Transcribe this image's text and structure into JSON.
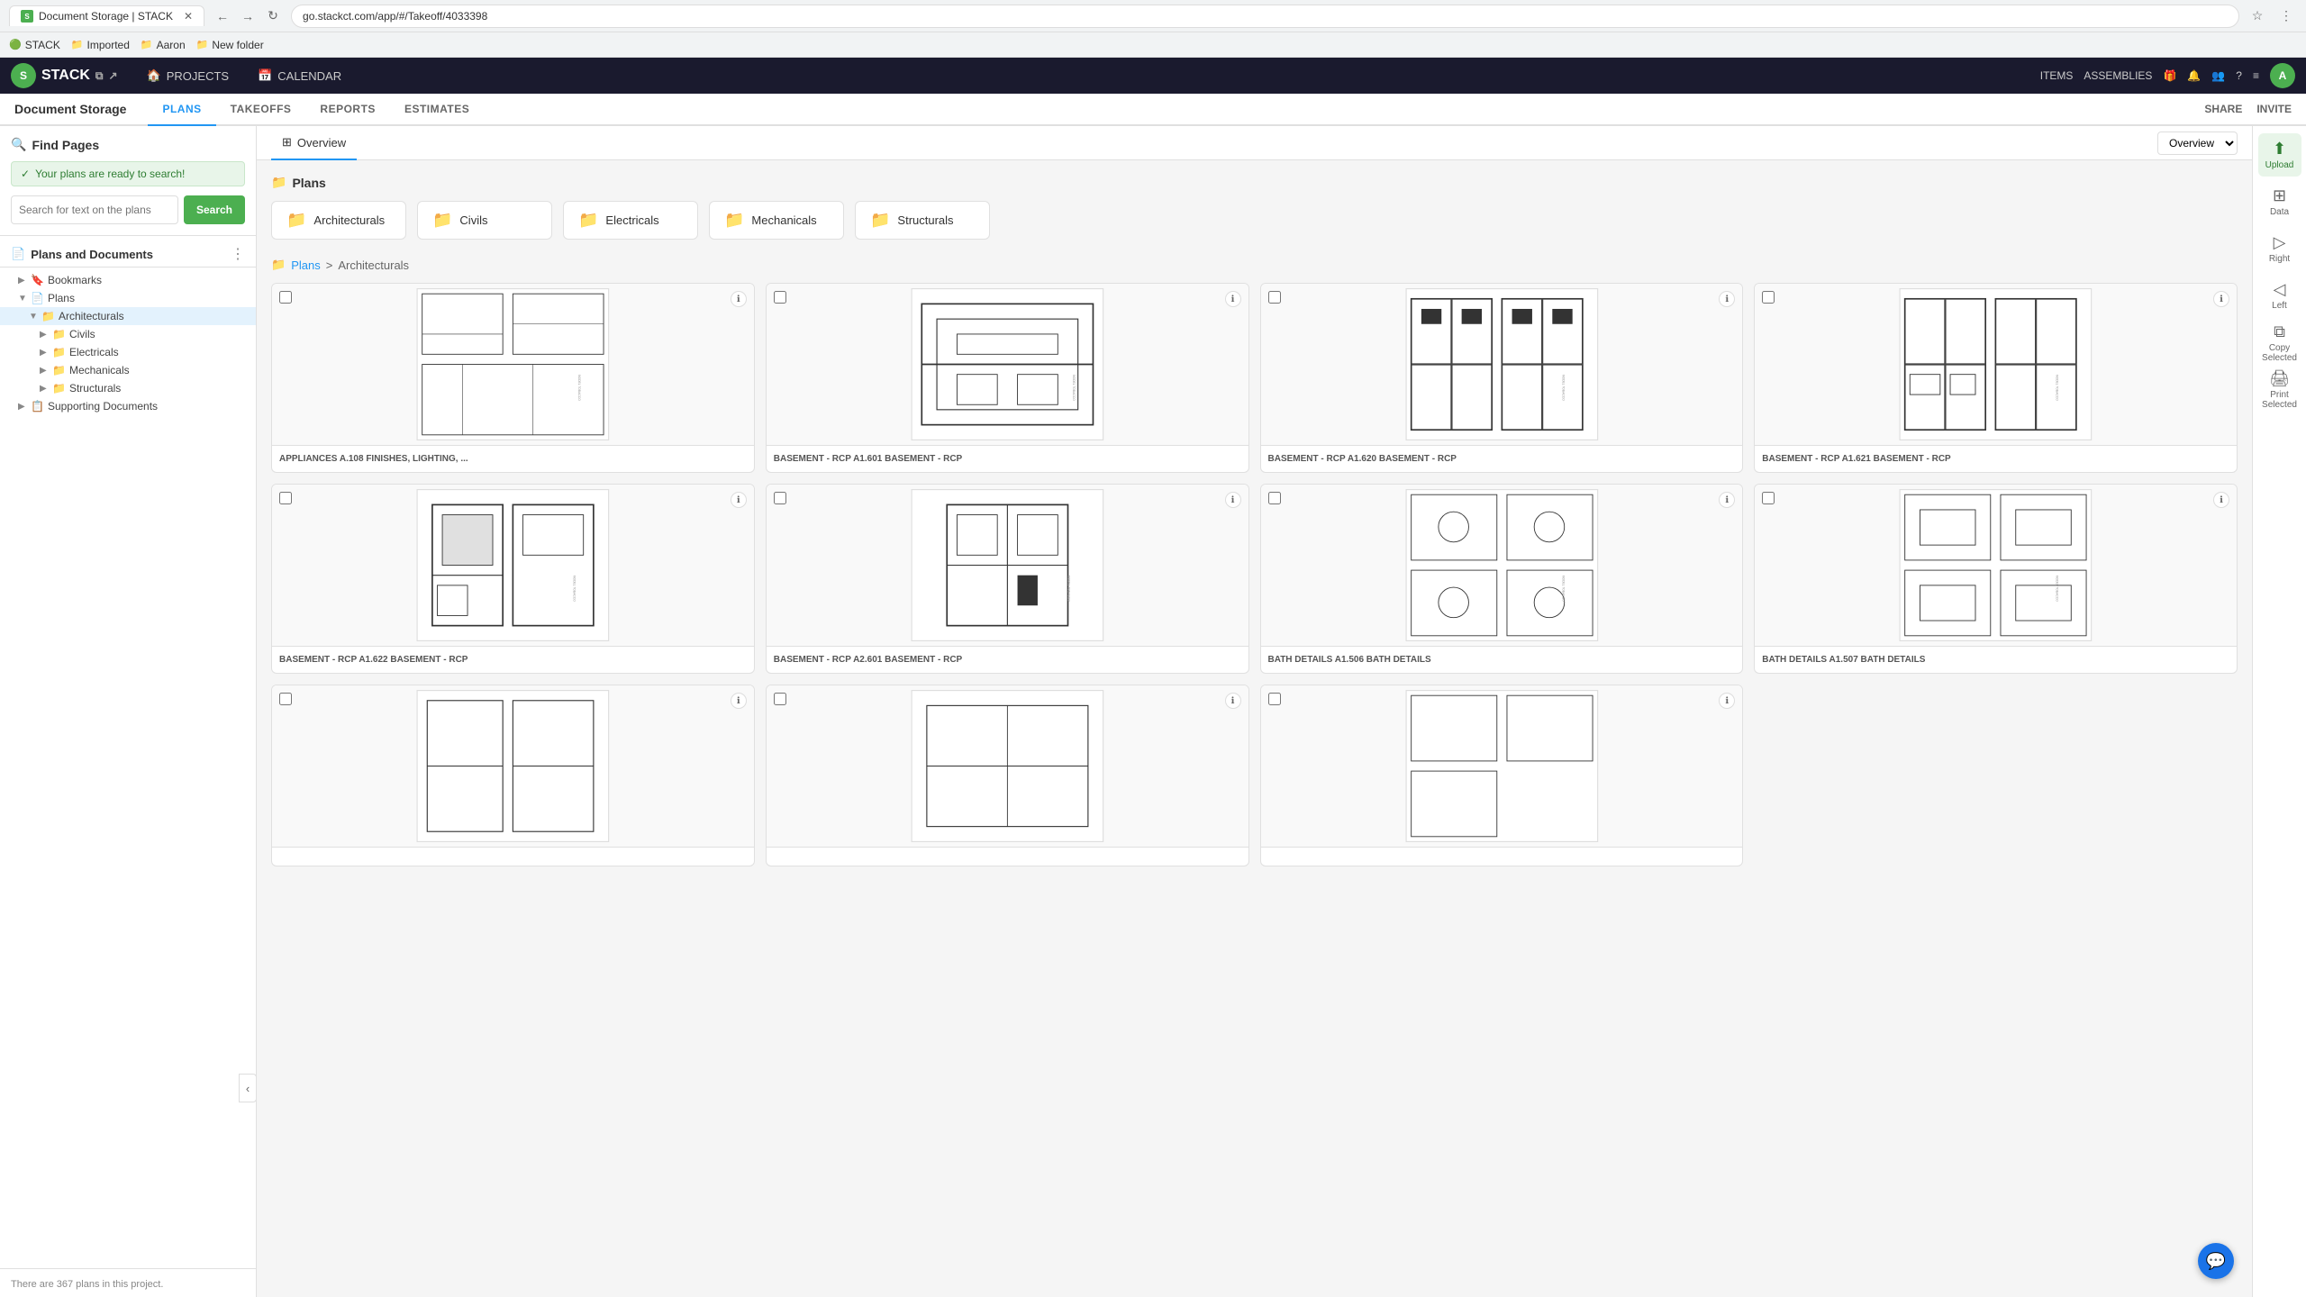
{
  "browser": {
    "tab_title": "Document Storage | STACK",
    "url": "go.stackct.com/app/#/Takeoff/4033398",
    "bookmarks": [
      {
        "label": "STACK",
        "icon": "🟢"
      },
      {
        "label": "Imported",
        "icon": "📁"
      },
      {
        "label": "Aaron",
        "icon": "📁"
      },
      {
        "label": "New folder",
        "icon": "📁"
      }
    ]
  },
  "app_header": {
    "logo": "STACK",
    "nav": [
      {
        "label": "PROJECTS",
        "icon": "🏠"
      },
      {
        "label": "CALENDAR",
        "icon": "📅"
      }
    ],
    "right_nav": [
      {
        "label": "ITEMS"
      },
      {
        "label": "ASSEMBLIES"
      },
      {
        "label": "🎁"
      },
      {
        "label": "🔔"
      },
      {
        "label": "👥"
      },
      {
        "label": "?"
      },
      {
        "label": "≡"
      }
    ]
  },
  "sub_nav": {
    "title": "Document Storage",
    "tabs": [
      "PLANS",
      "TAKEOFFS",
      "REPORTS",
      "ESTIMATES"
    ],
    "active_tab": "PLANS",
    "right_actions": [
      "SHARE",
      "INVITE"
    ]
  },
  "sidebar": {
    "find_pages_label": "Find Pages",
    "ready_message": "Your plans are ready to search!",
    "search_placeholder": "Search for text on the plans",
    "search_btn": "Search",
    "section_title": "Plans and Documents",
    "tree": [
      {
        "label": "Bookmarks",
        "level": 0,
        "type": "group",
        "expanded": false,
        "icon": "🔖"
      },
      {
        "label": "Plans",
        "level": 0,
        "type": "group",
        "expanded": true,
        "icon": "📄"
      },
      {
        "label": "Architecturals",
        "level": 1,
        "type": "folder",
        "expanded": true,
        "icon": "📁",
        "color": "blue"
      },
      {
        "label": "Civils",
        "level": 2,
        "type": "folder",
        "expanded": false,
        "icon": "📁",
        "color": "green"
      },
      {
        "label": "Electricals",
        "level": 2,
        "type": "folder",
        "expanded": false,
        "icon": "📁",
        "color": "yellow"
      },
      {
        "label": "Mechanicals",
        "level": 2,
        "type": "folder",
        "expanded": false,
        "icon": "📁",
        "color": "red"
      },
      {
        "label": "Structurals",
        "level": 2,
        "type": "folder",
        "expanded": false,
        "icon": "📁",
        "color": "purple"
      },
      {
        "label": "Supporting Documents",
        "level": 0,
        "type": "group",
        "expanded": false,
        "icon": "📋"
      }
    ]
  },
  "overview_tab": {
    "label": "Overview",
    "icon": "⊞",
    "select_value": "Overview"
  },
  "plans_section": {
    "label": "Plans",
    "folders": [
      {
        "label": "Architecturals",
        "color": "blue",
        "icon": "📁"
      },
      {
        "label": "Civils",
        "color": "green",
        "icon": "📁"
      },
      {
        "label": "Electricals",
        "color": "yellow",
        "icon": "📁"
      },
      {
        "label": "Mechanicals",
        "color": "red",
        "icon": "📁"
      },
      {
        "label": "Structurals",
        "color": "purple",
        "icon": "📁"
      }
    ]
  },
  "breadcrumb": {
    "parent": "Plans",
    "separator": ">",
    "current": "Architecturals"
  },
  "plan_cards": [
    {
      "label": "APPLIANCES A.108 FINISHES, LIGHTING, ..."
    },
    {
      "label": "BASEMENT - RCP A1.601 BASEMENT - RCP"
    },
    {
      "label": "BASEMENT - RCP A1.620 BASEMENT - RCP"
    },
    {
      "label": "BASEMENT - RCP A1.621 BASEMENT - RCP"
    },
    {
      "label": "BASEMENT - RCP A1.622 BASEMENT - RCP"
    },
    {
      "label": "BASEMENT - RCP A2.601 BASEMENT - RCP"
    },
    {
      "label": "BATH DETAILS A1.506 BATH DETAILS"
    },
    {
      "label": "BATH DETAILS A1.507 BATH DETAILS"
    },
    {
      "label": ""
    },
    {
      "label": ""
    },
    {
      "label": ""
    }
  ],
  "right_panel": {
    "buttons": [
      {
        "label": "Upload",
        "icon": "⬆"
      },
      {
        "label": "Data",
        "icon": "⊞"
      },
      {
        "label": "Right",
        "icon": "▷"
      },
      {
        "label": "Left",
        "icon": "◁"
      },
      {
        "label": "Copy Selected",
        "icon": "⧉"
      },
      {
        "label": "Print Selected",
        "icon": "🖨"
      }
    ]
  },
  "footer": {
    "plan_count": "There are 367 plans in this project."
  }
}
